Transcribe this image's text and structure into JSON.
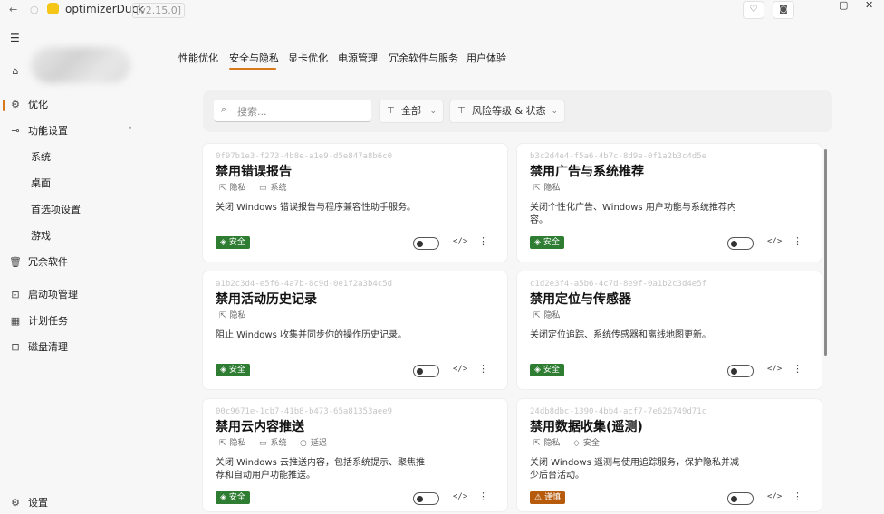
{
  "titlebar": {
    "back_icon": "arrow-left-icon",
    "refresh_icon": "refresh-icon",
    "app_name": "optimizerDuck",
    "version": "[v2.15.0]",
    "favorite_icon": "heart-icon",
    "screenshot_icon": "camera-icon",
    "minimize": "—",
    "maximize": "▢",
    "close": "✕"
  },
  "sidebar": {
    "menu_icon": "hamburger-icon",
    "home_label": "",
    "items": [
      {
        "label": "优化",
        "icon": "optimize-icon"
      },
      {
        "label": "功能设置",
        "icon": "toggle-icon"
      },
      {
        "label": "系统"
      },
      {
        "label": "桌面"
      },
      {
        "label": "首选项设置"
      },
      {
        "label": "游戏"
      },
      {
        "label": "冗余软件",
        "icon": "trash-icon"
      },
      {
        "label": "启动项管理",
        "icon": "startup-icon"
      },
      {
        "label": "计划任务",
        "icon": "calendar-icon"
      },
      {
        "label": "磁盘清理",
        "icon": "disk-icon"
      }
    ],
    "settings_label": "设置"
  },
  "tabs": [
    "性能优化",
    "安全与隐私",
    "显卡优化",
    "电源管理",
    "冗余软件与服务",
    "用户体验"
  ],
  "active_tab": "安全与隐私",
  "filters": {
    "search_placeholder": "搜索...",
    "category": "全部",
    "risk_status": "风险等级 & 状态"
  },
  "cards": [
    {
      "id": "0f97b1e3-f273-4b8e-a1e9-d5e847a8b6c0",
      "title": "禁用错误报告",
      "tags": [
        "隐私",
        "系统"
      ],
      "desc": "关闭 Windows 错误报告与程序兼容性助手服务。",
      "badge": "安全",
      "badge_color": "#2e7d32"
    },
    {
      "id": "b3c2d4e4-f5a6-4b7c-8d9e-0f1a2b3c4d5e",
      "title": "禁用广告与系统推荐",
      "tags": [
        "隐私"
      ],
      "desc": "关闭个性化广告、Windows 用户功能与系统推荐内容。",
      "badge": "安全",
      "badge_color": "#2e7d32"
    },
    {
      "id": "a1b2c3d4-e5f6-4a7b-8c9d-0e1f2a3b4c5d",
      "title": "禁用活动历史记录",
      "tags": [
        "隐私"
      ],
      "desc": "阻止 Windows 收集并同步你的操作历史记录。",
      "badge": "安全",
      "badge_color": "#2e7d32"
    },
    {
      "id": "c1d2e3f4-a5b6-4c7d-8e9f-0a1b2c3d4e5f",
      "title": "禁用定位与传感器",
      "tags": [
        "隐私"
      ],
      "desc": "关闭定位追踪、系统传感器和离线地图更新。",
      "badge": "安全",
      "badge_color": "#2e7d32"
    },
    {
      "id": "00c9671e-1cb7-41b8-b473-65a81353aee9",
      "title": "禁用云内容推送",
      "tags": [
        "隐私",
        "系统",
        "延迟"
      ],
      "desc": "关闭 Windows 云推送内容，包括系统提示、聚焦推荐和自动用户功能推送。",
      "badge": "安全",
      "badge_color": "#2e7d32"
    },
    {
      "id": "24db8dbc-1390-4bb4-acf7-7e626749d71c",
      "title": "禁用数据收集(遥测)",
      "tags": [
        "隐私",
        "安全"
      ],
      "desc": "关闭 Windows 遥测与使用追踪服务，保护隐私并减少后台活动。",
      "badge": "谨慎",
      "badge_color": "#b65a0b"
    }
  ],
  "colors": {
    "accent": "#d87a1c",
    "safe": "#2e7d32",
    "caution": "#b65a0b"
  }
}
